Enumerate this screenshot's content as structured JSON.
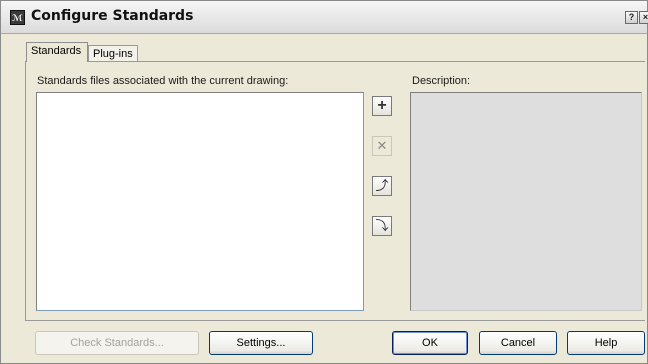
{
  "window": {
    "title": "Configure Standards",
    "icon": "app-icon",
    "title_buttons": {
      "help": "?",
      "close": "×"
    }
  },
  "tabs": [
    {
      "label": "Standards",
      "active": true
    },
    {
      "label": "Plug-ins",
      "active": false
    }
  ],
  "standards_tab": {
    "files_label": "Standards files associated with the current drawing:",
    "files": [],
    "description_label": "Description:",
    "description_text": ""
  },
  "side_buttons": {
    "add": {
      "glyph": "+",
      "enabled": true
    },
    "remove": {
      "glyph": "✕",
      "enabled": false
    },
    "move_up": {
      "glyph": "⤴",
      "enabled": true
    },
    "move_down": {
      "glyph": "⤵",
      "enabled": true
    }
  },
  "footer": {
    "check_standards": "Check Standards...",
    "settings": "Settings...",
    "ok": "OK",
    "cancel": "Cancel",
    "help": "Help"
  }
}
